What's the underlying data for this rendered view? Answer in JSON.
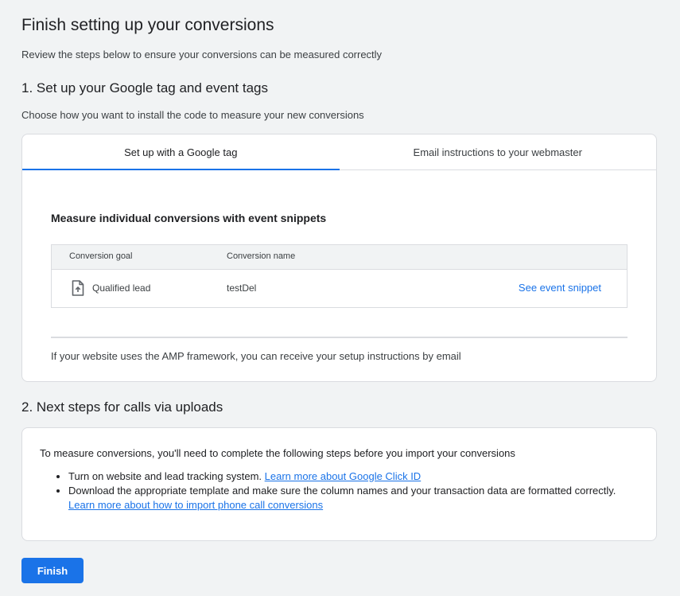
{
  "page": {
    "title": "Finish setting up your conversions",
    "subtitle": "Review the steps below to ensure your conversions can be measured correctly"
  },
  "section1": {
    "heading": "1. Set up your Google tag and event tags",
    "description": "Choose how you want to install the code to measure your new conversions",
    "tabs": [
      {
        "label": "Set up with a Google tag",
        "active": true
      },
      {
        "label": "Email instructions to your webmaster",
        "active": false
      }
    ],
    "snippets_heading": "Measure individual conversions with event snippets",
    "table": {
      "headers": [
        "Conversion goal",
        "Conversion name"
      ],
      "rows": [
        {
          "goal_icon": "document-upload-icon",
          "goal": "Qualified lead",
          "name": "testDel",
          "link": "See event snippet"
        }
      ]
    },
    "amp_note": "If your website uses the AMP framework, you can receive your setup instructions by email"
  },
  "section2": {
    "heading": "2. Next steps for calls via uploads",
    "intro": "To measure conversions, you'll need to complete the following steps before you import your conversions",
    "steps": [
      {
        "text": "Turn on website and lead tracking system.",
        "link": "Learn more about Google Click ID"
      },
      {
        "text": "Download the appropriate template and make sure the column names and your transaction data are formatted correctly.",
        "link": "Learn more about how to import phone call conversions"
      }
    ]
  },
  "actions": {
    "finish_label": "Finish"
  },
  "colors": {
    "accent": "#1a73e8",
    "background": "#f1f3f4",
    "border": "#dadce0"
  }
}
